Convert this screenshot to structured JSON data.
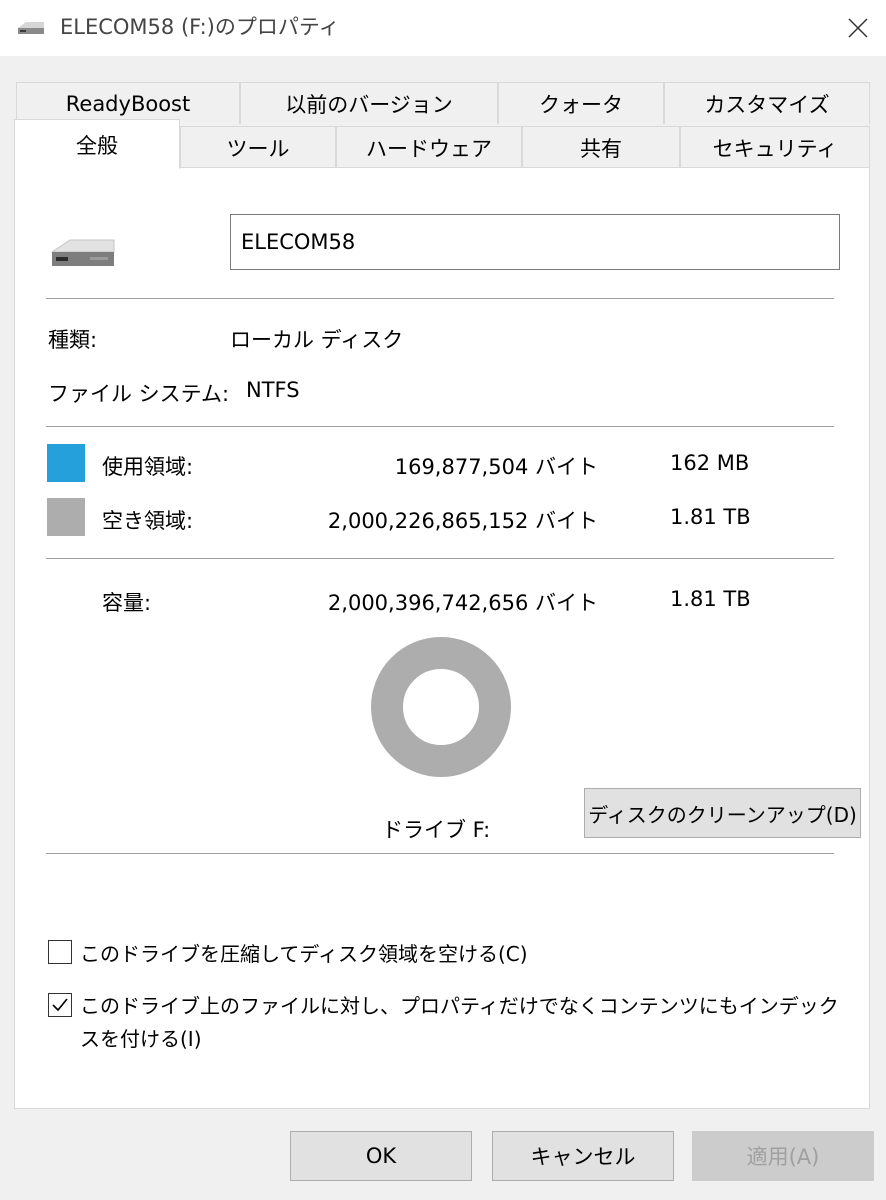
{
  "window": {
    "title": "ELECOM58 (F:)のプロパティ"
  },
  "tabs_back": [
    {
      "label": "ReadyBoost"
    },
    {
      "label": "以前のバージョン"
    },
    {
      "label": "クォータ"
    },
    {
      "label": "カスタマイズ"
    }
  ],
  "tabs_front": [
    {
      "label": "全般",
      "active": true
    },
    {
      "label": "ツール"
    },
    {
      "label": "ハードウェア"
    },
    {
      "label": "共有"
    },
    {
      "label": "セキュリティ"
    }
  ],
  "general": {
    "volume_name": "ELECOM58",
    "type_label": "種類:",
    "type_value": "ローカル ディスク",
    "fs_label": "ファイル システム:",
    "fs_value": "NTFS",
    "used": {
      "label": "使用領域:",
      "bytes": "169,877,504 バイト",
      "size": "162 MB",
      "color": "#26a0da"
    },
    "free": {
      "label": "空き領域:",
      "bytes": "2,000,226,865,152 バイト",
      "size": "1.81 TB",
      "color": "#adadad"
    },
    "capacity": {
      "label": "容量:",
      "bytes": "2,000,396,742,656 バイト",
      "size": "1.81 TB"
    },
    "drive_label": "ドライブ F:",
    "cleanup_button": "ディスクのクリーンアップ(D)",
    "compress_checkbox": {
      "label": "このドライブを圧縮してディスク領域を空ける(C)",
      "checked": false
    },
    "index_checkbox": {
      "label_line1": "このドライブ上のファイルに対し、プロパティだけでなくコンテンツにもインデック",
      "label_line2": "スを付ける(I)",
      "checked": true
    }
  },
  "buttons": {
    "ok": "OK",
    "cancel": "キャンセル",
    "apply": "適用(A)"
  },
  "chart_data": {
    "type": "pie",
    "categories": [
      "使用領域",
      "空き領域"
    ],
    "values": [
      169877504,
      2000226865152
    ],
    "colors": [
      "#26a0da",
      "#adadad"
    ]
  }
}
